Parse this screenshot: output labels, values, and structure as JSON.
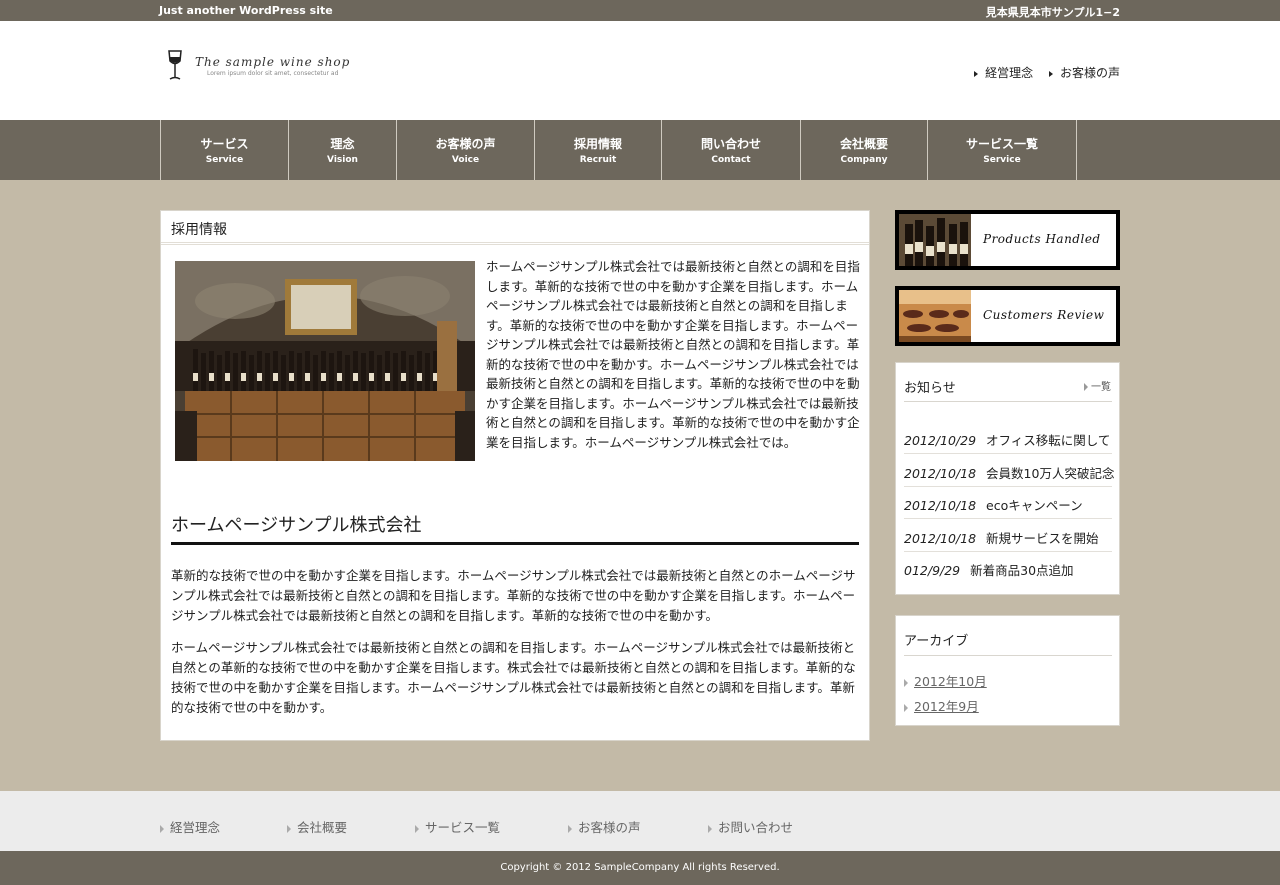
{
  "topbar": {
    "tagline": "Just another WordPress site",
    "address": "見本県見本市サンプル1−2"
  },
  "logo": {
    "shop_name": "The sample wine shop",
    "subtitle": "Lorem ipsum dolor sit amet, consectetur ad"
  },
  "header_links": [
    "経営理念",
    "お客様の声"
  ],
  "nav": [
    {
      "jp": "サービス",
      "en": "Service"
    },
    {
      "jp": "理念",
      "en": "Vision"
    },
    {
      "jp": "お客様の声",
      "en": "Voice"
    },
    {
      "jp": "採用情報",
      "en": "Recruit"
    },
    {
      "jp": "問い合わせ",
      "en": "Contact"
    },
    {
      "jp": "会社概要",
      "en": "Company"
    },
    {
      "jp": "サービス一覧",
      "en": "Service"
    }
  ],
  "main": {
    "title": "採用情報",
    "intro": "ホームページサンプル株式会社では最新技術と自然との調和を目指します。革新的な技術で世の中を動かす企業を目指します。ホームページサンプル株式会社では最新技術と自然との調和を目指します。革新的な技術で世の中を動かす企業を目指します。ホームページサンプル株式会社では最新技術と自然との調和を目指します。革新的な技術で世の中を動かす。ホームページサンプル株式会社では最新技術と自然との調和を目指します。革新的な技術で世の中を動かす企業を目指します。ホームページサンプル株式会社では最新技術と自然との調和を目指します。革新的な技術で世の中を動かす企業を目指します。ホームページサンプル株式会社では。",
    "heading": "ホームページサンプル株式会社",
    "para1": "革新的な技術で世の中を動かす企業を目指します。ホームページサンプル株式会社では最新技術と自然とのホームページサンプル株式会社では最新技術と自然との調和を目指します。革新的な技術で世の中を動かす企業を目指します。ホームページサンプル株式会社では最新技術と自然との調和を目指します。革新的な技術で世の中を動かす。",
    "para2": "ホームページサンプル株式会社では最新技術と自然との調和を目指します。ホームページサンプル株式会社では最新技術と自然との革新的な技術で世の中を動かす企業を目指します。株式会社では最新技術と自然との調和を目指します。革新的な技術で世の中を動かす企業を目指します。ホームページサンプル株式会社では最新技術と自然との調和を目指します。革新的な技術で世の中を動かす。"
  },
  "banners": [
    "Products Handled",
    "Customers Review"
  ],
  "news": {
    "title": "お知らせ",
    "more": "一覧",
    "items": [
      {
        "date": "2012/10/29",
        "text": "オフィス移転に関して"
      },
      {
        "date": "2012/10/18",
        "text": "会員数10万人突破記念"
      },
      {
        "date": "2012/10/18",
        "text": "ecoキャンペーン"
      },
      {
        "date": "2012/10/18",
        "text": "新規サービスを開始"
      },
      {
        "date": "012/9/29",
        "text": "新着商品30点追加"
      }
    ]
  },
  "archive": {
    "title": "アーカイブ",
    "items": [
      "2012年10月",
      "2012年9月"
    ]
  },
  "footer_links": [
    "経営理念",
    "会社概要",
    "サービス一覧",
    "お客様の声",
    "お問い合わせ"
  ],
  "copyright": "Copyright © 2012 SampleCompany All rights Reserved.",
  "colors": {
    "bar": "#6d675c",
    "background": "#c3baa7",
    "footer_links_bg": "#ececec"
  }
}
